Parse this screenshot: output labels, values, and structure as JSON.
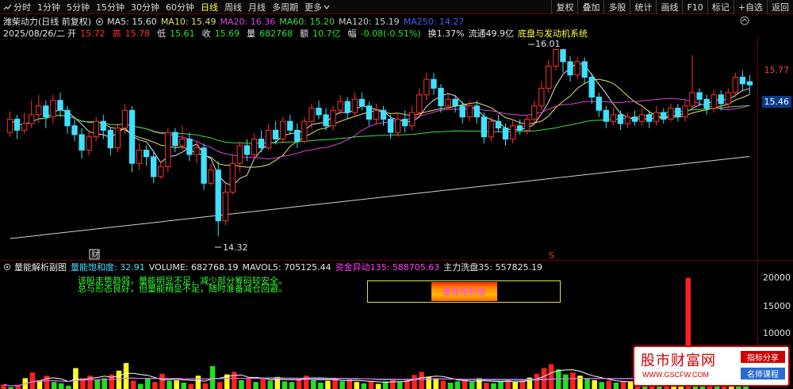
{
  "toolbar": {
    "periods": [
      "分时",
      "1分钟",
      "5分钟",
      "15分钟",
      "30分钟",
      "60分钟",
      "日线",
      "周线",
      "月线",
      "多周期",
      "更多"
    ],
    "active_period": "日线",
    "right_buttons": [
      "复权",
      "叠加",
      "多股",
      "统计",
      "画线",
      "F10",
      "标记",
      "+自选",
      "返回"
    ]
  },
  "info": {
    "stock": "潍柴动力(日线 前复权)",
    "ma5": "MA5: 15.60",
    "ma10": "MA10: 15.49",
    "ma20": "MA20: 16.36",
    "ma60": "MA60: 15.20",
    "ma120": "MA120: 15.19",
    "ma250": "MA250: 14.27",
    "date": "2025/08/26/二",
    "open_label": "开",
    "open": "15.72",
    "high_label": "高",
    "high": "15.78",
    "low_label": "低",
    "low": "15.61",
    "close_label": "收",
    "close": "15.69",
    "vol_label": "量",
    "vol": "682768",
    "amt_label": "额",
    "amt": "10.7亿",
    "chg_label": "幅",
    "chg": "-0.08(-0.51%)",
    "turn": "换1.37%",
    "float": "流通49.9亿",
    "system": "底盘与发动机系统"
  },
  "main_chart": {
    "high_label": "16.01",
    "low_label": "14.32",
    "marker_cai": "财",
    "marker_s": "S"
  },
  "price_axis": {
    "tag1": "15.77",
    "tag2": "15.46"
  },
  "sub_info": {
    "title": "量能解析副图",
    "sat": "量能饱和度: 32.91",
    "volume": "VOLUME: 682768.19",
    "mavol": "MAVOL5: 705125.44",
    "fund": "资金异动135: 588705.63",
    "wash": "主力洗盘35: 557825.19"
  },
  "notes": {
    "line1": "该股走势趋弱，量能明显不足，减少部分筹码较安全。",
    "line2": "总与形态良好，但量能稍显不足，随时准备减仓回避。",
    "box_label": "量能饱和度"
  },
  "vol_axis": [
    "20000",
    "15000",
    "10000"
  ],
  "logo": {
    "name": "股市财富网",
    "url": "WWW.GSCFW.COM",
    "tag1": "指标分享",
    "tag2": "名师课程"
  },
  "colors": {
    "up": "#ff3030",
    "down": "#40e0ff",
    "border": "#6b0000",
    "highlight": "#ffff33"
  },
  "chart_data": {
    "type": "candlestick",
    "candles": [
      [
        15.26,
        15.38,
        15.45,
        15.22
      ],
      [
        15.38,
        15.28,
        15.42,
        15.2
      ],
      [
        15.28,
        15.34,
        15.44,
        15.25
      ],
      [
        15.34,
        15.42,
        15.55,
        15.3
      ],
      [
        15.42,
        15.5,
        15.6,
        15.35
      ],
      [
        15.5,
        15.4,
        15.55,
        15.3
      ],
      [
        15.4,
        15.55,
        15.6,
        15.34
      ],
      [
        15.55,
        15.46,
        15.62,
        15.4
      ],
      [
        15.46,
        15.32,
        15.5,
        15.25
      ],
      [
        15.32,
        15.24,
        15.38,
        15.18
      ],
      [
        15.24,
        15.1,
        15.3,
        15.02
      ],
      [
        15.1,
        15.22,
        15.26,
        15.05
      ],
      [
        15.22,
        15.36,
        15.4,
        15.18
      ],
      [
        15.36,
        15.28,
        15.42,
        15.2
      ],
      [
        15.28,
        15.12,
        15.3,
        15.05
      ],
      [
        15.12,
        15.3,
        15.34,
        15.08
      ],
      [
        15.3,
        15.46,
        15.52,
        15.25
      ],
      [
        15.46,
        14.98,
        15.5,
        14.9
      ],
      [
        14.98,
        15.1,
        15.16,
        14.92
      ],
      [
        15.1,
        15.04,
        15.14,
        14.96
      ],
      [
        15.04,
        14.86,
        15.08,
        14.8
      ],
      [
        14.86,
        14.95,
        15.0,
        14.84
      ],
      [
        14.95,
        15.26,
        15.3,
        14.9
      ],
      [
        15.26,
        15.14,
        15.3,
        15.08
      ],
      [
        15.14,
        15.2,
        15.32,
        15.1
      ],
      [
        15.2,
        15.06,
        15.26,
        15.0
      ],
      [
        15.06,
        15.12,
        15.18,
        14.98
      ],
      [
        15.12,
        14.8,
        15.16,
        14.74
      ],
      [
        14.8,
        14.92,
        14.98,
        14.78
      ],
      [
        14.92,
        14.46,
        15.0,
        14.32
      ],
      [
        14.46,
        14.72,
        14.8,
        14.42
      ],
      [
        14.72,
        14.98,
        15.05,
        14.7
      ],
      [
        14.98,
        15.14,
        15.18,
        14.9
      ],
      [
        15.14,
        15.06,
        15.2,
        15.0
      ],
      [
        15.06,
        15.2,
        15.25,
        15.02
      ],
      [
        15.2,
        15.12,
        15.28,
        15.08
      ],
      [
        15.12,
        15.28,
        15.34,
        15.1
      ],
      [
        15.28,
        15.2,
        15.36,
        15.15
      ],
      [
        15.2,
        15.36,
        15.4,
        15.16
      ],
      [
        15.36,
        15.28,
        15.42,
        15.24
      ],
      [
        15.28,
        15.18,
        15.34,
        15.12
      ],
      [
        15.18,
        15.36,
        15.4,
        15.16
      ],
      [
        15.36,
        15.48,
        15.52,
        15.3
      ],
      [
        15.48,
        15.42,
        15.55,
        15.38
      ],
      [
        15.42,
        15.32,
        15.48,
        15.28
      ],
      [
        15.32,
        15.46,
        15.5,
        15.28
      ],
      [
        15.46,
        15.54,
        15.6,
        15.42
      ],
      [
        15.54,
        15.44,
        15.58,
        15.38
      ],
      [
        15.44,
        15.56,
        15.62,
        15.4
      ],
      [
        15.56,
        15.5,
        15.62,
        15.46
      ],
      [
        15.5,
        15.38,
        15.54,
        15.32
      ],
      [
        15.38,
        15.46,
        15.52,
        15.34
      ],
      [
        15.46,
        15.38,
        15.5,
        15.32
      ],
      [
        15.38,
        15.26,
        15.42,
        15.2
      ],
      [
        15.26,
        15.38,
        15.44,
        15.22
      ],
      [
        15.38,
        15.32,
        15.46,
        15.26
      ],
      [
        15.32,
        15.44,
        15.5,
        15.28
      ],
      [
        15.44,
        15.6,
        15.66,
        15.4
      ],
      [
        15.6,
        15.74,
        15.8,
        15.55
      ],
      [
        15.74,
        15.66,
        15.8,
        15.6
      ],
      [
        15.66,
        15.5,
        15.7,
        15.44
      ],
      [
        15.5,
        15.56,
        15.62,
        15.46
      ],
      [
        15.56,
        15.5,
        15.6,
        15.44
      ],
      [
        15.5,
        15.4,
        15.54,
        15.34
      ],
      [
        15.4,
        15.5,
        15.55,
        15.36
      ],
      [
        15.5,
        15.4,
        15.55,
        15.34
      ],
      [
        15.4,
        15.22,
        15.44,
        15.16
      ],
      [
        15.22,
        15.36,
        15.4,
        15.18
      ],
      [
        15.36,
        15.3,
        15.42,
        15.26
      ],
      [
        15.3,
        15.2,
        15.34,
        15.14
      ],
      [
        15.2,
        15.32,
        15.38,
        15.16
      ],
      [
        15.32,
        15.28,
        15.38,
        15.24
      ],
      [
        15.28,
        15.38,
        15.42,
        15.24
      ],
      [
        15.38,
        15.5,
        15.55,
        15.34
      ],
      [
        15.5,
        15.66,
        15.72,
        15.46
      ],
      [
        15.66,
        15.86,
        15.92,
        15.62
      ],
      [
        15.86,
        16.01,
        16.01,
        15.82
      ],
      [
        16.01,
        15.9,
        16.01,
        15.8
      ],
      [
        15.9,
        15.78,
        15.95,
        15.72
      ],
      [
        15.78,
        15.9,
        15.94,
        15.74
      ],
      [
        15.9,
        15.76,
        15.94,
        15.7
      ],
      [
        15.76,
        15.58,
        15.8,
        15.52
      ],
      [
        15.58,
        15.46,
        15.62,
        15.4
      ],
      [
        15.46,
        15.36,
        15.5,
        15.3
      ],
      [
        15.36,
        15.42,
        15.48,
        15.32
      ],
      [
        15.42,
        15.34,
        15.46,
        15.28
      ],
      [
        15.34,
        15.4,
        15.44,
        15.3
      ],
      [
        15.4,
        15.36,
        15.46,
        15.32
      ],
      [
        15.36,
        15.42,
        15.48,
        15.32
      ],
      [
        15.42,
        15.36,
        15.46,
        15.3
      ],
      [
        15.36,
        15.44,
        15.5,
        15.32
      ],
      [
        15.44,
        15.38,
        15.48,
        15.34
      ],
      [
        15.38,
        15.48,
        15.52,
        15.36
      ],
      [
        15.48,
        15.4,
        15.52,
        15.36
      ],
      [
        15.4,
        15.5,
        15.55,
        15.36
      ],
      [
        15.5,
        15.62,
        15.96,
        15.48
      ],
      [
        15.62,
        15.56,
        15.66,
        15.5
      ],
      [
        15.56,
        15.48,
        15.6,
        15.42
      ],
      [
        15.48,
        15.6,
        15.64,
        15.44
      ],
      [
        15.6,
        15.52,
        15.64,
        15.46
      ],
      [
        15.52,
        15.62,
        15.66,
        15.48
      ],
      [
        15.62,
        15.76,
        15.8,
        15.58
      ],
      [
        15.76,
        15.7,
        15.82,
        15.64
      ],
      [
        15.72,
        15.69,
        15.78,
        15.61
      ]
    ],
    "volumes": [
      4200,
      3800,
      4100,
      5200,
      6100,
      4800,
      5600,
      4600,
      4400,
      4000,
      6800,
      5200,
      5600,
      4900,
      5200,
      5800,
      6400,
      7600,
      4800,
      4300,
      5200,
      4600,
      5900,
      4800,
      4900,
      4500,
      4300,
      5600,
      4400,
      7100,
      4600,
      5800,
      6200,
      4900,
      5100,
      4600,
      5300,
      4800,
      5400,
      4700,
      4600,
      5200,
      5600,
      4900,
      4500,
      4800,
      5200,
      4700,
      5000,
      4600,
      4400,
      4800,
      4300,
      4700,
      4900,
      4600,
      5100,
      5700,
      6200,
      5400,
      5200,
      4800,
      4500,
      4700,
      4900,
      4600,
      5200,
      4500,
      4400,
      4700,
      4900,
      4600,
      4800,
      5300,
      5900,
      6800,
      7400,
      6600,
      5800,
      6100,
      5600,
      5200,
      4900,
      4600,
      4800,
      4500,
      4700,
      4600,
      4800,
      4500,
      4600,
      4400,
      4700,
      4500,
      4600,
      21000,
      5600,
      5200,
      5400,
      5000,
      5600,
      5800,
      5500,
      5400
    ]
  }
}
